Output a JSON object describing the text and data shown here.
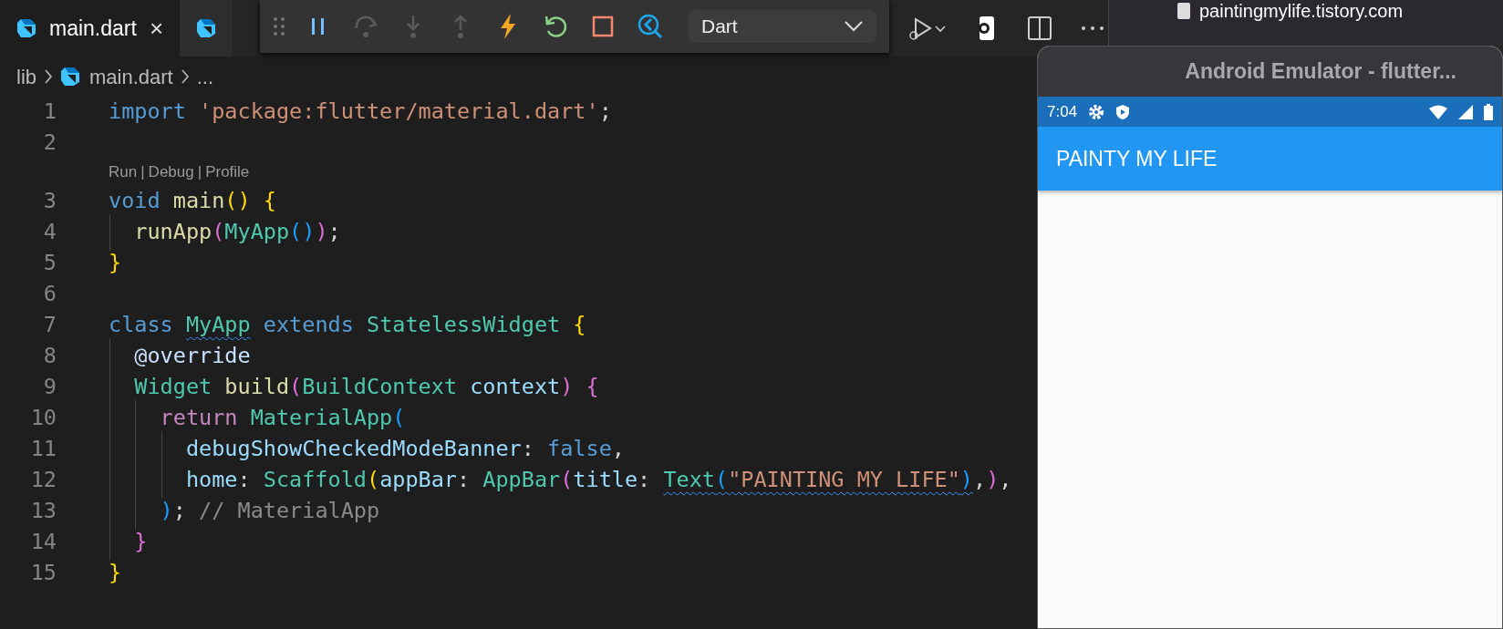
{
  "editor_tabs": [
    {
      "label": "main.dart",
      "selected": true,
      "close_glyph": "×"
    },
    {
      "selected": false
    }
  ],
  "debug_toolbar": {
    "buttons": [
      {
        "kind": "pause",
        "disabled": false
      },
      {
        "kind": "step-over",
        "disabled": true
      },
      {
        "kind": "step-into",
        "disabled": true
      },
      {
        "kind": "step-out",
        "disabled": true
      },
      {
        "kind": "hot-reload",
        "disabled": false
      },
      {
        "kind": "restart",
        "disabled": false
      },
      {
        "kind": "stop",
        "disabled": false
      },
      {
        "kind": "inspector",
        "disabled": false
      }
    ],
    "config_select": {
      "value": "Dart"
    }
  },
  "editor_actions": [
    {
      "kind": "run-debug"
    },
    {
      "kind": "device"
    },
    {
      "kind": "split"
    },
    {
      "kind": "more"
    }
  ],
  "browser": {
    "url": "paintingmylife.tistory.com"
  },
  "breadcrumbs": [
    {
      "label": "lib",
      "kind": "folder"
    },
    {
      "label": "main.dart",
      "kind": "dart-file"
    },
    {
      "label": "...",
      "kind": "symbol"
    }
  ],
  "code_lines": [
    {
      "number": "1",
      "tokens": [
        {
          "text": "import ",
          "kind": "keyword"
        },
        {
          "text": "'package:flutter/material.dart'",
          "kind": "string"
        },
        {
          "text": ";",
          "kind": "plain"
        }
      ]
    },
    {
      "number": "2"
    },
    {
      "number": "3",
      "codelens": {
        "links": [
          "Run",
          "Debug",
          "Profile"
        ],
        "separator": "|"
      },
      "tokens": [
        {
          "text": "void ",
          "kind": "keyword"
        },
        {
          "text": "main",
          "kind": "func"
        },
        {
          "text": "() ",
          "kind": "bracket1"
        },
        {
          "text": "{",
          "kind": "bracket1"
        }
      ],
      "children": [
        {
          "number": "4",
          "tokens": [
            {
              "text": "runApp",
              "kind": "func"
            },
            {
              "text": "(",
              "kind": "bracket2"
            },
            {
              "text": "MyApp",
              "kind": "type"
            },
            {
              "text": "()",
              "kind": "bracket3"
            },
            {
              "text": ")",
              "kind": "bracket2"
            },
            {
              "text": ";",
              "kind": "plain"
            }
          ]
        }
      ]
    },
    {
      "number": "5",
      "tokens": [
        {
          "text": "}",
          "kind": "bracket1"
        }
      ]
    },
    {
      "number": "6"
    },
    {
      "number": "7",
      "tokens": [
        {
          "text": "class ",
          "kind": "keyword"
        },
        {
          "text": "MyApp",
          "kind": "type",
          "squiggle": true
        },
        {
          "text": " extends ",
          "kind": "keyword"
        },
        {
          "text": "StatelessWidget ",
          "kind": "type"
        },
        {
          "text": "{",
          "kind": "bracket1"
        }
      ],
      "children": [
        {
          "number": "8",
          "tokens": [
            {
              "text": "@override",
              "kind": "annotation"
            }
          ]
        },
        {
          "number": "9",
          "tokens": [
            {
              "text": "Widget ",
              "kind": "type"
            },
            {
              "text": "build",
              "kind": "func"
            },
            {
              "text": "(",
              "kind": "bracket2"
            },
            {
              "text": "BuildContext ",
              "kind": "type"
            },
            {
              "text": "context",
              "kind": "param"
            },
            {
              "text": ") ",
              "kind": "bracket2"
            },
            {
              "text": "{",
              "kind": "bracket2"
            }
          ],
          "children": [
            {
              "number": "10",
              "tokens": [
                {
                  "text": "return ",
                  "kind": "control"
                },
                {
                  "text": "MaterialApp",
                  "kind": "type"
                },
                {
                  "text": "(",
                  "kind": "bracket3"
                }
              ],
              "children": [
                {
                  "number": "11",
                  "tokens": [
                    {
                      "text": "debugShowCheckedModeBanner",
                      "kind": "param"
                    },
                    {
                      "text": ": ",
                      "kind": "plain"
                    },
                    {
                      "text": "false",
                      "kind": "keyword"
                    },
                    {
                      "text": ",",
                      "kind": "plain"
                    }
                  ]
                },
                {
                  "number": "12",
                  "tokens": [
                    {
                      "text": "home",
                      "kind": "param"
                    },
                    {
                      "text": ": ",
                      "kind": "plain"
                    },
                    {
                      "text": "Scaffold",
                      "kind": "type"
                    },
                    {
                      "text": "(",
                      "kind": "bracket1"
                    },
                    {
                      "text": "appBar",
                      "kind": "param"
                    },
                    {
                      "text": ": ",
                      "kind": "plain"
                    },
                    {
                      "text": "AppBar",
                      "kind": "type"
                    },
                    {
                      "text": "(",
                      "kind": "bracket2"
                    },
                    {
                      "text": "title",
                      "kind": "param"
                    },
                    {
                      "text": ": ",
                      "kind": "plain"
                    },
                    {
                      "text": "Text",
                      "kind": "type",
                      "squiggle": true
                    },
                    {
                      "text": "(",
                      "kind": "bracket3",
                      "squiggle": true
                    },
                    {
                      "text": "\"PAINTING MY LIFE\"",
                      "kind": "string",
                      "squiggle": true
                    },
                    {
                      "text": ")",
                      "kind": "bracket3",
                      "squiggle": true
                    },
                    {
                      "text": ",",
                      "kind": "plain"
                    },
                    {
                      "text": ")",
                      "kind": "bracket2"
                    },
                    {
                      "text": ",",
                      "kind": "plain"
                    }
                  ]
                }
              ]
            },
            {
              "number": "13",
              "tokens": [
                {
                  "text": ")",
                  "kind": "bracket3"
                },
                {
                  "text": "; ",
                  "kind": "plain"
                },
                {
                  "text": "// MaterialApp",
                  "kind": "comment"
                }
              ]
            }
          ]
        },
        {
          "number": "14",
          "tokens": [
            {
              "text": "}",
              "kind": "bracket2"
            }
          ]
        }
      ]
    },
    {
      "number": "15",
      "tokens": [
        {
          "text": "}",
          "kind": "bracket1"
        }
      ]
    }
  ],
  "emulator": {
    "title": "Android Emulator - flutter...",
    "status_bar": {
      "time": "7:04"
    },
    "app_bar": {
      "title": "PAINTY MY LIFE"
    }
  }
}
